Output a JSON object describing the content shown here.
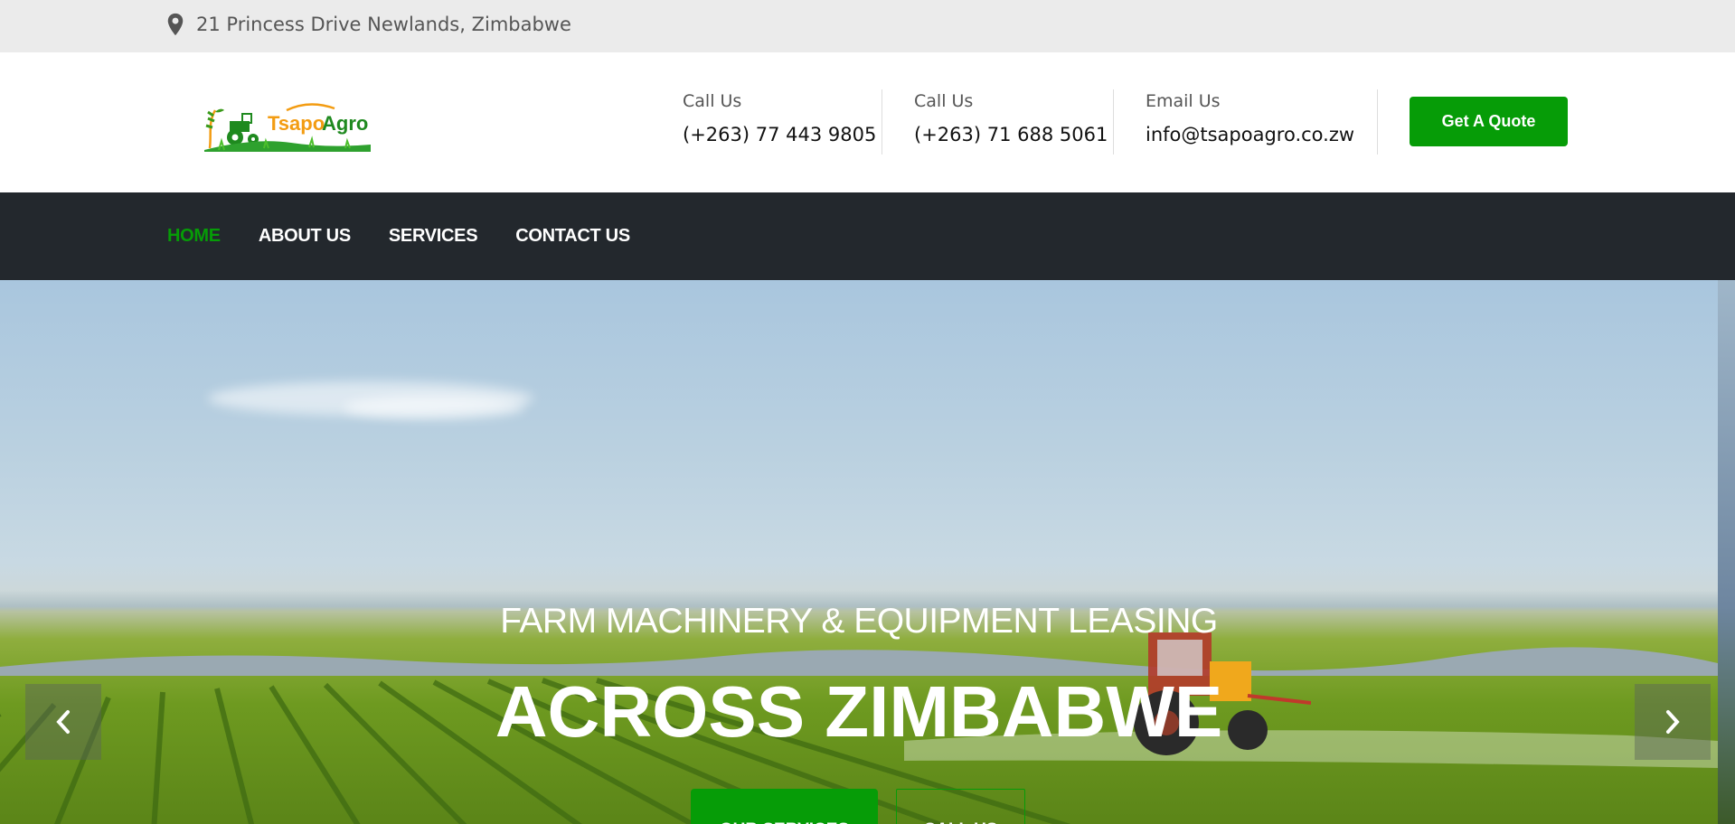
{
  "topbar": {
    "address": "21 Princess Drive Newlands, Zimbabwe",
    "icon": "map-pin-icon"
  },
  "header": {
    "logo_text_part1": "Tsapo",
    "logo_text_part2": "Agro",
    "contacts": [
      {
        "label": "Call Us",
        "value": "(+263) 77 443 9805"
      },
      {
        "label": "Call Us",
        "value": "(+263) 71 688 5061"
      },
      {
        "label": "Email Us",
        "value": "info@tsapoagro.co.zw"
      }
    ],
    "quote_button": "Get A Quote"
  },
  "nav": {
    "items": [
      {
        "label": "HOME",
        "active": true
      },
      {
        "label": "ABOUT US",
        "active": false
      },
      {
        "label": "SERVICES",
        "active": false
      },
      {
        "label": "CONTACT US",
        "active": false
      }
    ]
  },
  "hero": {
    "subtitle": "FARM MACHINERY & EQUIPMENT LEASING",
    "title": "ACROSS ZIMBABWE",
    "primary_button": "OUR SERVICES",
    "secondary_button": "CALL US",
    "prev_icon": "chevron-left-icon",
    "next_icon": "chevron-right-icon"
  },
  "colors": {
    "brand_green": "#069c07",
    "nav_bg": "#23282d",
    "topbar_bg": "#ebebeb",
    "logo_orange": "#f39c12"
  }
}
